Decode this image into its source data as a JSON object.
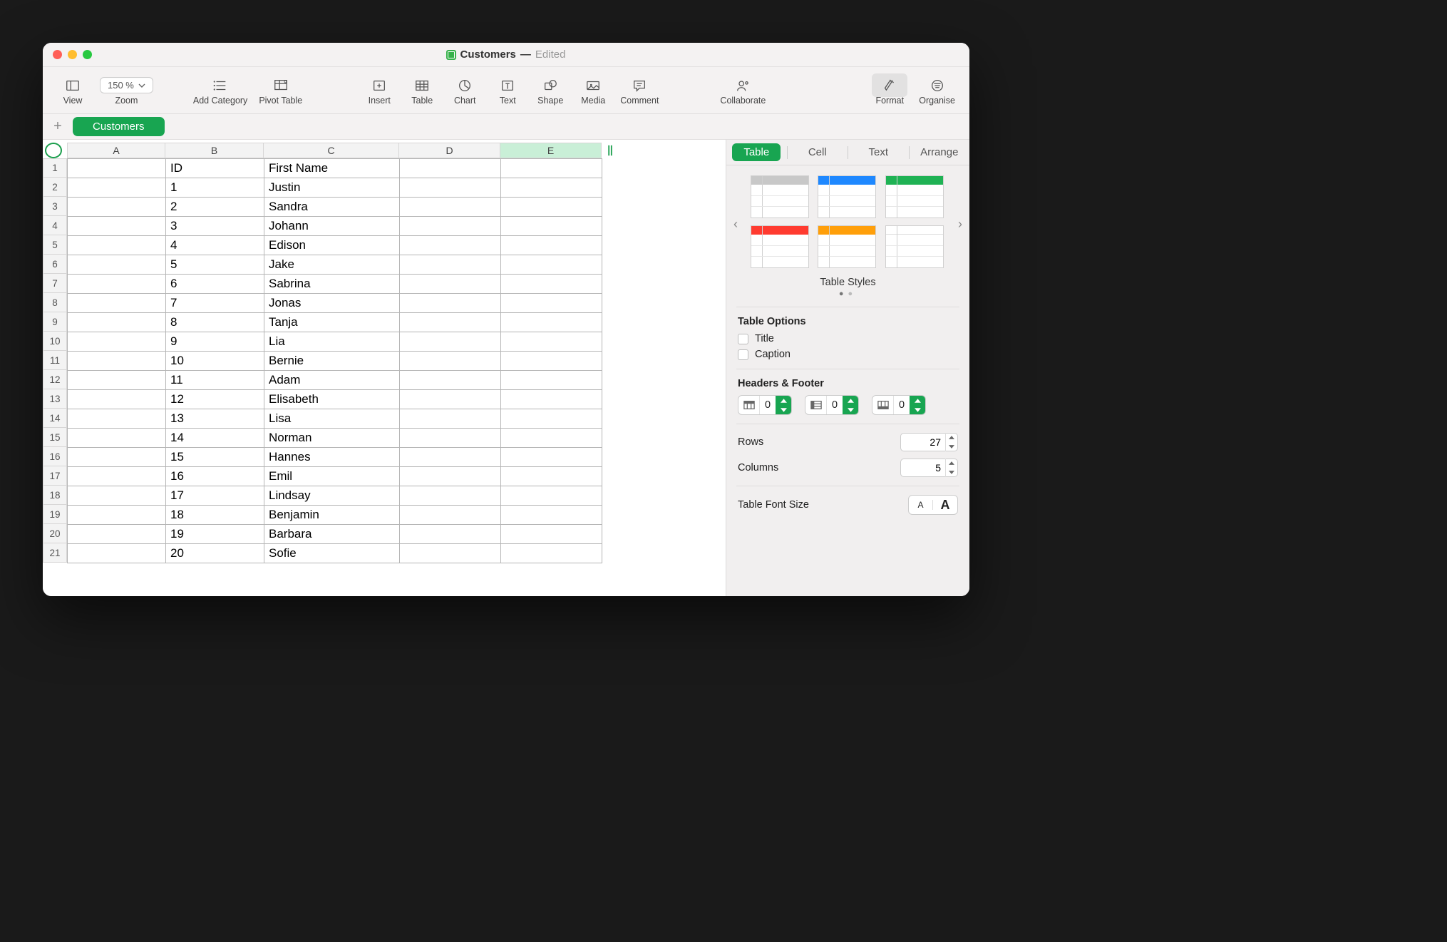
{
  "title": {
    "doc": "Customers",
    "status": "Edited"
  },
  "toolbar": {
    "view": "View",
    "zoom_label": "Zoom",
    "zoom_value": "150 %",
    "add_category": "Add Category",
    "pivot": "Pivot Table",
    "insert": "Insert",
    "table": "Table",
    "chart": "Chart",
    "text": "Text",
    "shape": "Shape",
    "media": "Media",
    "comment": "Comment",
    "collaborate": "Collaborate",
    "format": "Format",
    "organise": "Organise"
  },
  "sheet": {
    "name": "Customers"
  },
  "columns": [
    "A",
    "B",
    "C",
    "D",
    "E"
  ],
  "rows": [
    {
      "n": 1,
      "b": "ID",
      "c": "First Name"
    },
    {
      "n": 2,
      "b": "1",
      "c": "Justin"
    },
    {
      "n": 3,
      "b": "2",
      "c": "Sandra"
    },
    {
      "n": 4,
      "b": "3",
      "c": "Johann"
    },
    {
      "n": 5,
      "b": "4",
      "c": "Edison"
    },
    {
      "n": 6,
      "b": "5",
      "c": "Jake"
    },
    {
      "n": 7,
      "b": "6",
      "c": "Sabrina"
    },
    {
      "n": 8,
      "b": "7",
      "c": "Jonas"
    },
    {
      "n": 9,
      "b": "8",
      "c": "Tanja"
    },
    {
      "n": 10,
      "b": "9",
      "c": "Lia"
    },
    {
      "n": 11,
      "b": "10",
      "c": "Bernie"
    },
    {
      "n": 12,
      "b": "11",
      "c": "Adam"
    },
    {
      "n": 13,
      "b": "12",
      "c": "Elisabeth"
    },
    {
      "n": 14,
      "b": "13",
      "c": "Lisa"
    },
    {
      "n": 15,
      "b": "14",
      "c": "Norman"
    },
    {
      "n": 16,
      "b": "15",
      "c": "Hannes"
    },
    {
      "n": 17,
      "b": "16",
      "c": "Emil"
    },
    {
      "n": 18,
      "b": "17",
      "c": "Lindsay"
    },
    {
      "n": 19,
      "b": "18",
      "c": "Benjamin"
    },
    {
      "n": 20,
      "b": "19",
      "c": "Barbara"
    },
    {
      "n": 21,
      "b": "20",
      "c": "Sofie"
    }
  ],
  "inspector": {
    "tabs": {
      "table": "Table",
      "cell": "Cell",
      "text": "Text",
      "arrange": "Arrange"
    },
    "styles_label": "Table Styles",
    "options_title": "Table Options",
    "opt_title": "Title",
    "opt_caption": "Caption",
    "hf_title": "Headers & Footer",
    "hf_vals": {
      "rows": "0",
      "cols": "0",
      "footer": "0"
    },
    "rows_label": "Rows",
    "rows_value": "27",
    "cols_label": "Columns",
    "cols_value": "5",
    "font_size_label": "Table Font Size",
    "font_small": "A",
    "font_big": "A"
  }
}
